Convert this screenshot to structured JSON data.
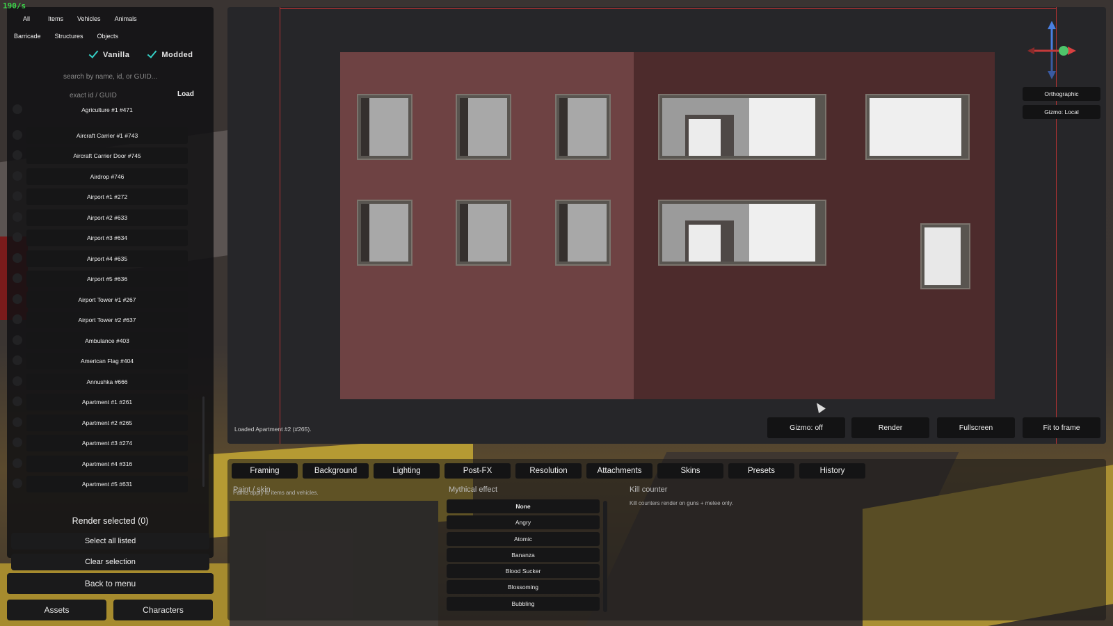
{
  "fps": "190/s",
  "filters": {
    "row1": [
      "All",
      "Items",
      "Vehicles",
      "Animals"
    ],
    "row2": [
      "Barricade",
      "Structures",
      "Objects"
    ]
  },
  "toggles": {
    "vanilla": "Vanilla",
    "modded": "Modded"
  },
  "search": {
    "placeholder": "search by name, id, or GUID...",
    "exact_placeholder": "exact id / GUID",
    "load": "Load"
  },
  "assets": [
    "Agriculture #1   #471",
    "Aircraft Carrier #1   #743",
    "Aircraft Carrier Door   #745",
    "Airdrop   #746",
    "Airport #1   #272",
    "Airport #2   #633",
    "Airport #3   #634",
    "Airport #4   #635",
    "Airport #5   #636",
    "Airport Tower #1   #267",
    "Airport Tower #2   #637",
    "Ambulance   #403",
    "American Flag   #404",
    "Annushka   #666",
    "Apartment #1   #261",
    "Apartment #2   #265",
    "Apartment #3   #274",
    "Apartment #4   #316",
    "Apartment #5   #631"
  ],
  "panel_actions": {
    "render_selected": "Render selected (0)",
    "select_all": "Select all listed",
    "clear_selection": "Clear selection",
    "back": "Back to menu"
  },
  "bottom_tabs": {
    "assets": "Assets",
    "characters": "Characters"
  },
  "viewport": {
    "status": "Loaded Apartment #2 (#265).",
    "buttons": {
      "gizmo": "Gizmo: off",
      "render": "Render",
      "fullscreen": "Fullscreen",
      "fit": "Fit to frame"
    },
    "side": {
      "ortho": "Orthographic",
      "gizmo_local": "Gizmo: Local"
    }
  },
  "settings": {
    "tabs": [
      "Framing",
      "Background",
      "Lighting",
      "Post-FX",
      "Resolution",
      "Attachments",
      "Skins",
      "Presets",
      "History"
    ],
    "paint_title": "Paint / skin",
    "paint_note": "Paints apply to items and vehicles.",
    "mythical_title": "Mythical effect",
    "effects": [
      "None",
      "Angry",
      "Atomic",
      "Bananza",
      "Blood Sucker",
      "Blossoming",
      "Bubbling"
    ],
    "kill_title": "Kill counter",
    "kill_note": "Kill counters render on guns + melee only."
  },
  "colors": {
    "frame_red": "#b23333",
    "check_teal": "#35d1c7",
    "fps_green": "#3bd64a",
    "building_left": "#6e4243",
    "building_right": "#4d2b2c"
  }
}
